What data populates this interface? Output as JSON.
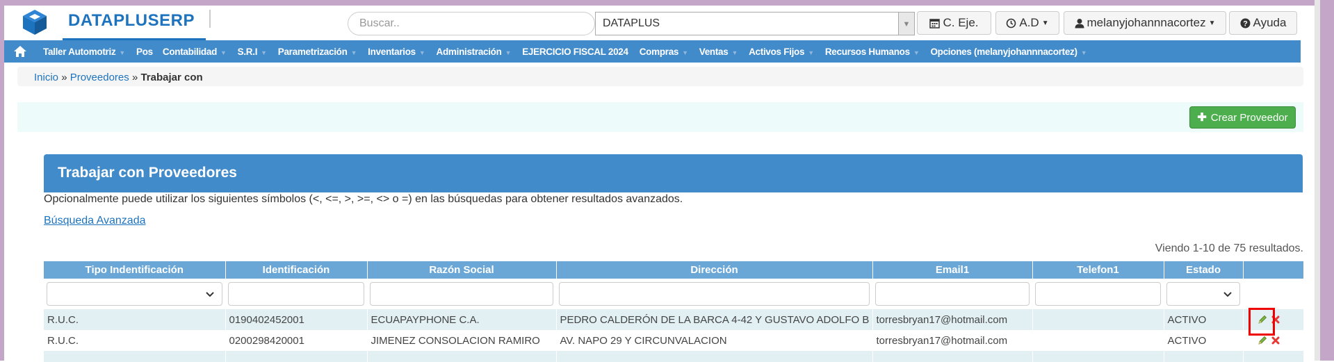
{
  "app": {
    "brand": "DATAPLUSERP",
    "search_placeholder": "Buscar..",
    "company": "DATAPLUS",
    "buttons": {
      "ce": "C. Eje.",
      "ad": "A.D",
      "user": "melanyjohannnacortez",
      "help": "Ayuda"
    }
  },
  "nav": {
    "items": [
      "Taller Automotriz",
      "Pos",
      "Contabilidad",
      "S.R.I",
      "Parametrización",
      "Inventarios",
      "Administración",
      "EJERCICIO FISCAL 2024",
      "Compras",
      "Ventas",
      "Activos Fijos",
      "Recursos Humanos",
      "Opciones (melanyjohannnacortez)"
    ]
  },
  "breadcrumb": {
    "home": "Inicio",
    "sep": "»",
    "parent": "Proveedores",
    "current": "Trabajar con"
  },
  "toolbar": {
    "create_label": "Crear Proveedor"
  },
  "panel": {
    "title": "Trabajar con Proveedores",
    "help": "Opcionalmente puede utilizar los siguientes símbolos (<, <=, >, >=, <> o =) en las búsquedas para obtener resultados avanzados.",
    "advanced": "Búsqueda Avanzada",
    "summary": "Viendo 1-10 de 75 resultados."
  },
  "table": {
    "headers": [
      "Tipo Indentificación",
      "Identificación",
      "Razón Social",
      "Dirección",
      "Email1",
      "Telefon1",
      "Estado",
      ""
    ],
    "rows": [
      [
        "R.U.C.",
        "0190402452001",
        "ECUAPAYPHONE C.A.",
        "PEDRO CALDERÓN DE LA BARCA 4-42 Y GUSTAVO ADOLFO B",
        "torresbryan17@hotmail.com",
        "",
        "ACTIVO"
      ],
      [
        "R.U.C.",
        "0200298420001",
        "JIMENEZ CONSOLACION RAMIRO",
        "AV. NAPO 29 Y CIRCUNVALACION",
        "torresbryan17@hotmail.com",
        "",
        "ACTIVO"
      ]
    ]
  },
  "colors": {
    "brand": "#1e73be",
    "nav": "#428bca",
    "header_row": "#6aa7d6",
    "success": "#4cae4c",
    "highlight": "#ee0000"
  },
  "icons": [
    "home-icon",
    "calendar-icon",
    "clock-icon",
    "user-icon",
    "question-icon",
    "plus-icon",
    "pencil-icon",
    "delete-icon"
  ]
}
